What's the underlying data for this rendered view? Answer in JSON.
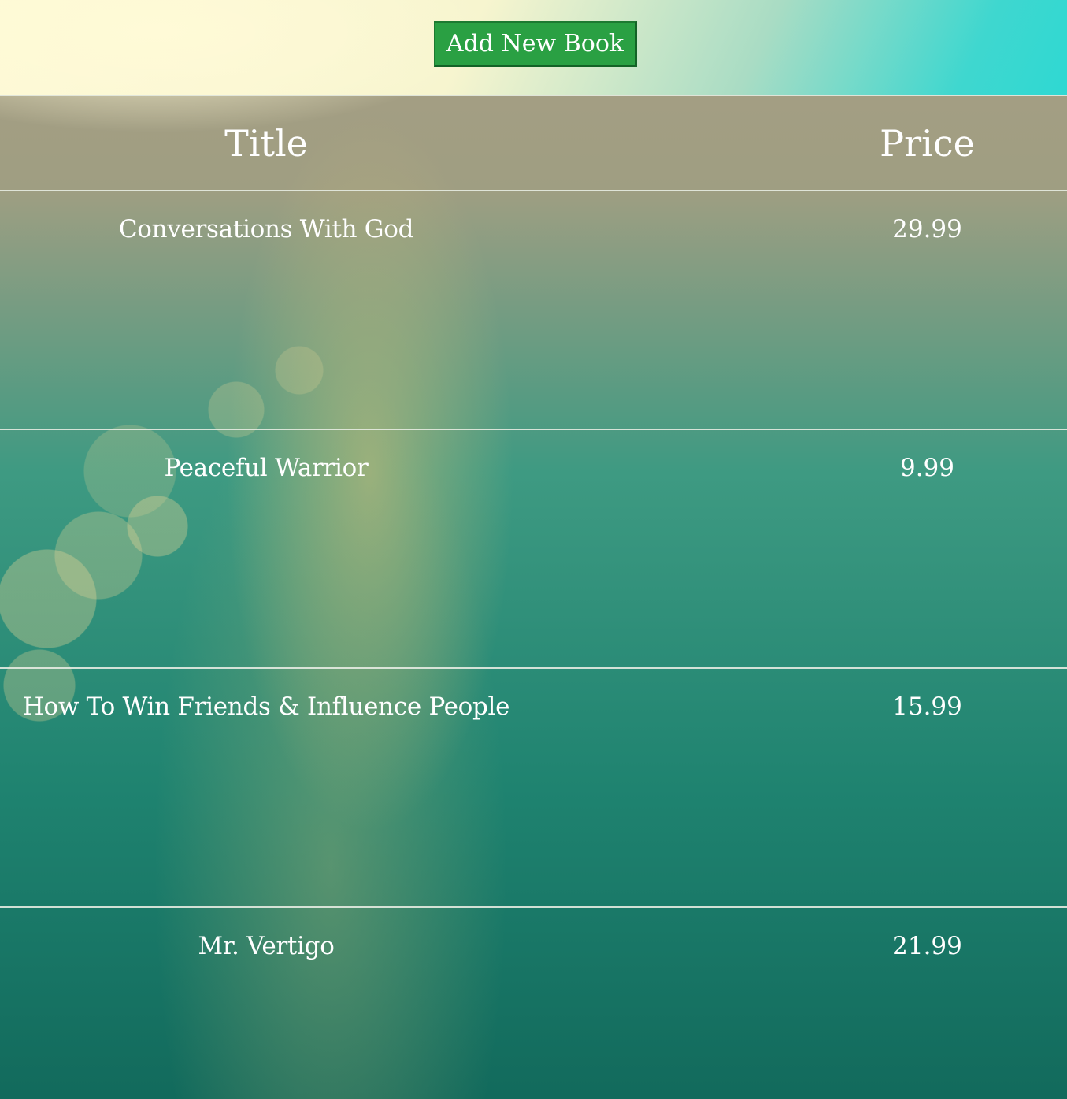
{
  "toolbar": {
    "add_button_label": "Add New Book"
  },
  "table": {
    "headers": {
      "title": "Title",
      "price": "Price"
    },
    "rows": [
      {
        "title": "Conversations With God",
        "price": "29.99"
      },
      {
        "title": "Peaceful Warrior",
        "price": "9.99"
      },
      {
        "title": "How To Win Friends & Influence People",
        "price": "15.99"
      },
      {
        "title": "Mr. Vertigo",
        "price": "21.99"
      }
    ]
  },
  "colors": {
    "button_background": "#2aa043",
    "text": "#ffffff",
    "divider": "#e6ebe1"
  }
}
